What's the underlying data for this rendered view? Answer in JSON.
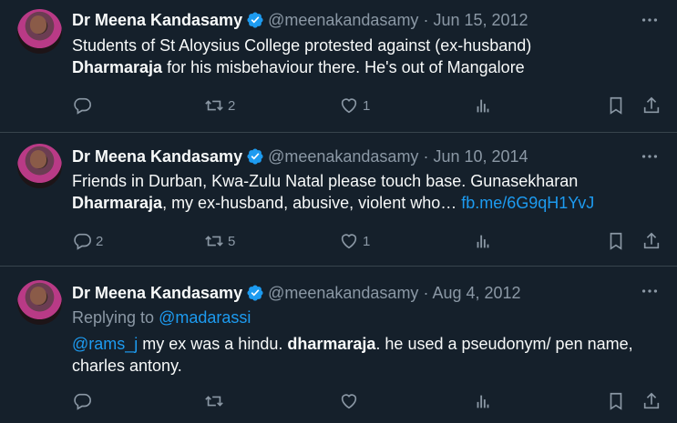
{
  "tweets": [
    {
      "name": "Dr Meena Kandasamy",
      "handle": "@meenakandasamy",
      "separator": "·",
      "date": "Jun 15, 2012",
      "text_line1": "Students of St Aloysius College protested against (ex-husband)",
      "text_bold": "Dharmaraja",
      "text_rest": " for his misbehaviour there. He's out of Mangalore",
      "reply_count": "",
      "retweet_count": "2",
      "like_count": "1"
    },
    {
      "name": "Dr Meena Kandasamy",
      "handle": "@meenakandasamy",
      "separator": "·",
      "date": "Jun 10, 2014",
      "text_line1": "Friends in Durban, Kwa-Zulu Natal please touch base. Gunasekharan",
      "text_bold": "Dharmaraja",
      "text_rest": ", my ex-husband, abusive, violent who… ",
      "link": "fb.me/6G9qH1YvJ",
      "reply_count": "2",
      "retweet_count": "5",
      "like_count": "1"
    },
    {
      "name": "Dr Meena Kandasamy",
      "handle": "@meenakandasamy",
      "separator": "·",
      "date": "Aug 4, 2012",
      "replying_prefix": "Replying to ",
      "replying_to": "@madarassi",
      "mention": "@rams_j",
      "text_part1": " my ex was a hindu. ",
      "text_bold": "dharmaraja",
      "text_part2": ". he used a pseudonym/ pen name,",
      "text_line2": "charles antony.",
      "reply_count": "",
      "retweet_count": "",
      "like_count": ""
    }
  ],
  "colors": {
    "background": "#15202b",
    "text": "#f7f9f9",
    "muted": "#8b98a5",
    "accent": "#1d9bf0",
    "divider": "#38444d"
  },
  "icons": [
    "verified-badge-icon",
    "more-icon",
    "reply-icon",
    "retweet-icon",
    "like-icon",
    "views-icon",
    "bookmark-icon",
    "share-icon"
  ]
}
